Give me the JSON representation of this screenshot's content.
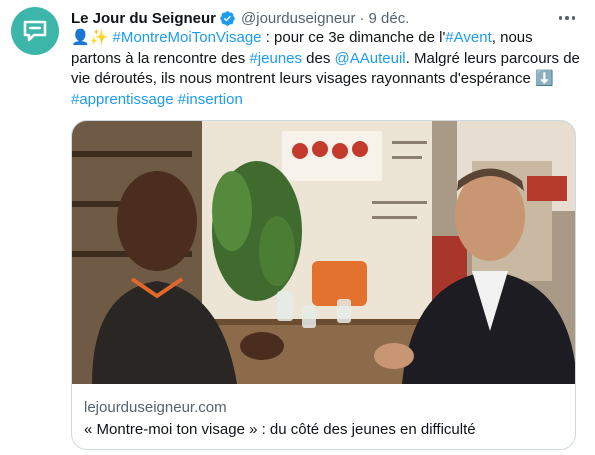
{
  "tweet": {
    "author_name": "Le Jour du Seigneur",
    "handle": "@jourduseigneur",
    "separator": "·",
    "time": "9 déc.",
    "text": {
      "emoji1": "👤✨",
      "hashtag1": "#MontreMoiTonVisage",
      "t1": " : pour ce 3e dimanche de l'",
      "hashtag2": "#Avent",
      "t2": ", nous partons à la rencontre des ",
      "hashtag3": "#jeunes",
      "t3": " des ",
      "mention1": "@AAuteuil",
      "t4": ". Malgré leurs parcours de vie déroutés, ils nous montrent leurs visages rayonnants d'espérance ",
      "emoji2": "⬇️",
      "hashtag4": "#apprentissage",
      "hashtag5": "#insertion"
    }
  },
  "card": {
    "domain": "lejourduseigneur.com",
    "title": "« Montre-moi ton visage » : du côté des jeunes en difficulté"
  },
  "colors": {
    "link": "#1d9bf0",
    "avatar_bg": "#3cb6a8",
    "verified": "#1d9bf0",
    "secondary_text": "#536471",
    "border": "#cfd9de"
  },
  "icons": {
    "avatar": "speech-bubble-logo",
    "verified": "verified-badge-icon",
    "more": "more-options-icon"
  }
}
